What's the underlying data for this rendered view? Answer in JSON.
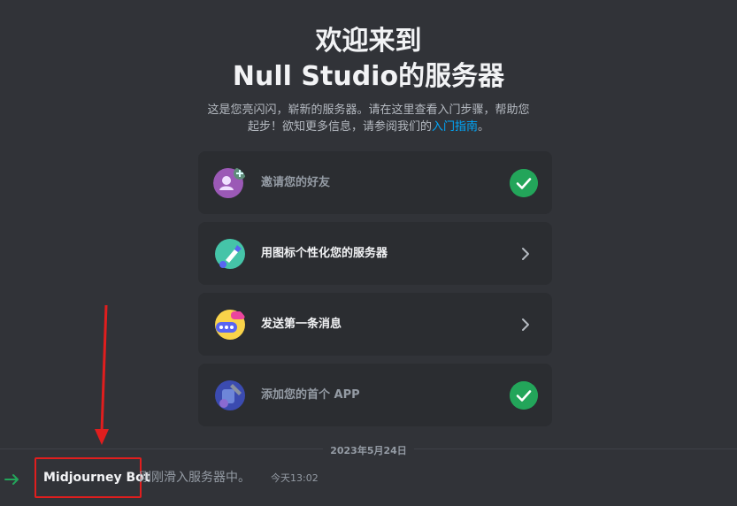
{
  "welcome": {
    "title_line1": "欢迎来到",
    "title_line2": "Null Studio的服务器",
    "desc_line1": "这是您亮闪闪，崭新的服务器。请在这里查看入门步骤，帮助您",
    "desc_line2_pre": "起步！欲知更多信息，请参阅我们的",
    "desc_link": "入门指南",
    "desc_line2_post": "。"
  },
  "checklist": [
    {
      "label": "邀请您的好友",
      "done": true,
      "icon": "invite-friends-icon"
    },
    {
      "label": "用图标个性化您的服务器",
      "done": false,
      "icon": "personalize-icon"
    },
    {
      "label": "发送第一条消息",
      "done": false,
      "icon": "message-icon"
    },
    {
      "label": "添加您的首个 APP",
      "done": true,
      "icon": "app-icon"
    }
  ],
  "date_divider": "2023年5月24日",
  "message": {
    "author": "Midjourney Bot",
    "text": "刚刚滑入服务器中。",
    "timestamp": "今天13:02"
  },
  "colors": {
    "background": "#313338",
    "card": "#2b2d31",
    "success": "#23a55a",
    "link": "#00a8fc",
    "annotation": "#e01e1e"
  }
}
